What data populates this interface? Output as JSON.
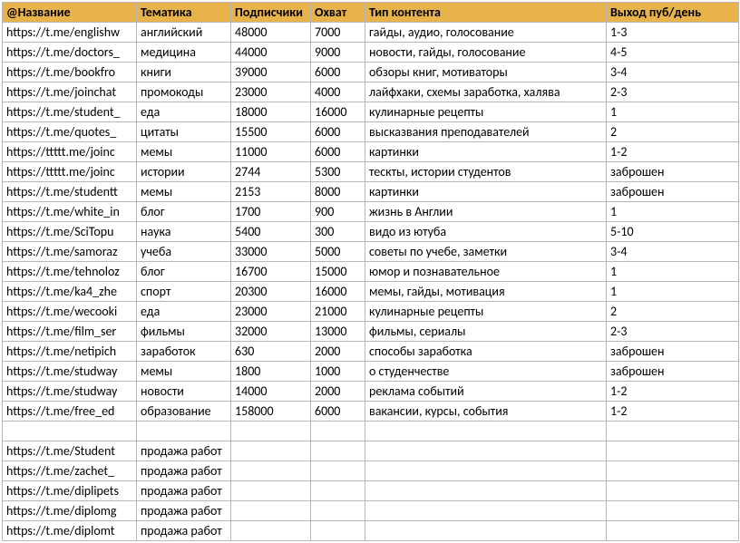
{
  "headers": {
    "name": "@Название",
    "topic": "Тематика",
    "subs": "Подписчики",
    "reach": "Охват",
    "ctype": "Тип контента",
    "pub": "Выход пуб/день"
  },
  "rows": [
    {
      "name": "https://t.me/englishw",
      "topic": "английский",
      "subs": "48000",
      "reach": "7000",
      "ctype": "гайды, аудио, голосование",
      "pub": "1-3"
    },
    {
      "name": "https://t.me/doctors_",
      "topic": "медицина",
      "subs": "44000",
      "reach": "9000",
      "ctype": "новости, гайды, голосование",
      "pub": "4-5"
    },
    {
      "name": "https://t.me/bookfro",
      "topic": "книги",
      "subs": "39000",
      "reach": "6000",
      "ctype": "обзоры книг, мотиваторы",
      "pub": "3-4"
    },
    {
      "name": "https://t.me/joinchat",
      "topic": "промокоды",
      "subs": "23000",
      "reach": "4000",
      "ctype": "лайфхаки, схемы заработка, халява",
      "pub": "2-3"
    },
    {
      "name": "https://t.me/student_",
      "topic": "еда",
      "subs": "18000",
      "reach": "16000",
      "ctype": "кулинарные рецепты",
      "pub": "1"
    },
    {
      "name": "https://t.me/quotes_",
      "topic": "цитаты",
      "subs": "15500",
      "reach": "6000",
      "ctype": "высказвания преподавателей",
      "pub": "2"
    },
    {
      "name": "https://ttttt.me/joinc",
      "topic": "мемы",
      "subs": "11000",
      "reach": "6000",
      "ctype": "картинки",
      "pub": "1-2"
    },
    {
      "name": "https://ttttt.me/joinc",
      "topic": "истории",
      "subs": "2744",
      "reach": "5300",
      "ctype": "тескты, истории студентов",
      "pub": "заброшен"
    },
    {
      "name": "https://t.me/studentt",
      "topic": "мемы",
      "subs": "2153",
      "reach": "8000",
      "ctype": "картинки",
      "pub": "заброшен"
    },
    {
      "name": "https://t.me/white_in",
      "topic": "блог",
      "subs": "1700",
      "reach": "900",
      "ctype": "жизнь в Англии",
      "pub": "1"
    },
    {
      "name": "https://t.me/SciTopu",
      "topic": "наука",
      "subs": "5400",
      "reach": "300",
      "ctype": "видо из ютуба",
      "pub": "5-10"
    },
    {
      "name": "https://t.me/samoraz",
      "topic": "учеба",
      "subs": "33000",
      "reach": "5000",
      "ctype": "советы по учебе, заметки",
      "pub": "3-4"
    },
    {
      "name": "https://t.me/tehnoloz",
      "topic": "блог",
      "subs": "16700",
      "reach": "15000",
      "ctype": "юмор и познавательное",
      "pub": "1"
    },
    {
      "name": "https://t.me/ka4_zhe",
      "topic": "спорт",
      "subs": "20300",
      "reach": "16000",
      "ctype": "мемы, гайды, мотивация",
      "pub": "1"
    },
    {
      "name": "https://t.me/wecooki",
      "topic": "еда",
      "subs": "23000",
      "reach": "21000",
      "ctype": "кулинарные рецепты",
      "pub": "2"
    },
    {
      "name": "https://t.me/film_ser",
      "topic": "фильмы",
      "subs": "32000",
      "reach": "13000",
      "ctype": "фильмы, сериалы",
      "pub": "2-3"
    },
    {
      "name": "https://t.me/netipich",
      "topic": "заработок",
      "subs": "630",
      "reach": "2000",
      "ctype": "способы заработка",
      "pub": "заброшен"
    },
    {
      "name": "https://t.me/studway",
      "topic": "мемы",
      "subs": "1800",
      "reach": "1000",
      "ctype": "о студенчестве",
      "pub": "заброшен"
    },
    {
      "name": "https://t.me/studway",
      "topic": "новости",
      "subs": "14000",
      "reach": "2000",
      "ctype": "реклама событий",
      "pub": "1-2"
    },
    {
      "name": "https://t.me/free_ed",
      "topic": "образование",
      "subs": "158000",
      "reach": "6000",
      "ctype": "вакансии, курсы, события",
      "pub": "1-2"
    },
    {
      "name": "",
      "topic": "",
      "subs": "",
      "reach": "",
      "ctype": "",
      "pub": ""
    },
    {
      "name": "https://t.me/Student",
      "topic": "продажа работ",
      "subs": "",
      "reach": "",
      "ctype": "",
      "pub": ""
    },
    {
      "name": "https://t.me/zachet_",
      "topic": "продажа работ",
      "subs": "",
      "reach": "",
      "ctype": "",
      "pub": ""
    },
    {
      "name": "https://t.me/diplipets",
      "topic": "продажа работ",
      "subs": "",
      "reach": "",
      "ctype": "",
      "pub": ""
    },
    {
      "name": "https://t.me/diplomg",
      "topic": "продажа работ",
      "subs": "",
      "reach": "",
      "ctype": "",
      "pub": ""
    },
    {
      "name": "https://t.me/diplomt",
      "topic": "продажа работ",
      "subs": "",
      "reach": "",
      "ctype": "",
      "pub": ""
    }
  ]
}
